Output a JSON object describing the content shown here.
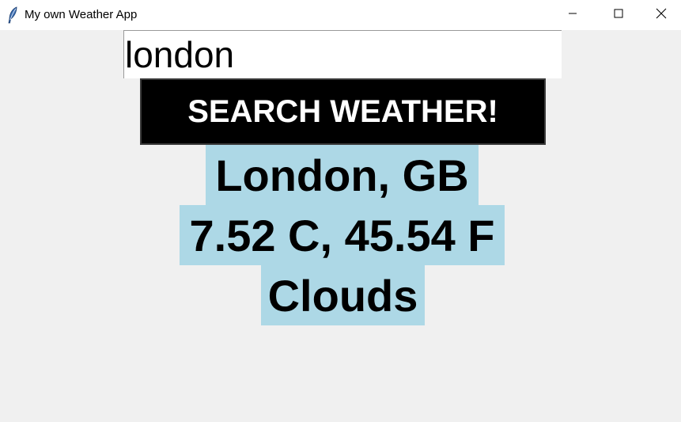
{
  "window": {
    "title": "My own Weather App",
    "app_icon": "feather-icon",
    "controls": {
      "minimize_icon": "minimize-icon",
      "maximize_icon": "maximize-icon",
      "close_icon": "close-icon"
    }
  },
  "search": {
    "value": "london"
  },
  "search_button": {
    "label": "SEARCH WEATHER!"
  },
  "result": {
    "location": "London, GB",
    "temperature": "7.52 C, 45.54 F",
    "condition": "Clouds"
  },
  "colors": {
    "background": "#f0f0f0",
    "titlebar": "#ffffff",
    "button_bg": "#000000",
    "button_text": "#ffffff",
    "result_bg": "#add8e6"
  }
}
